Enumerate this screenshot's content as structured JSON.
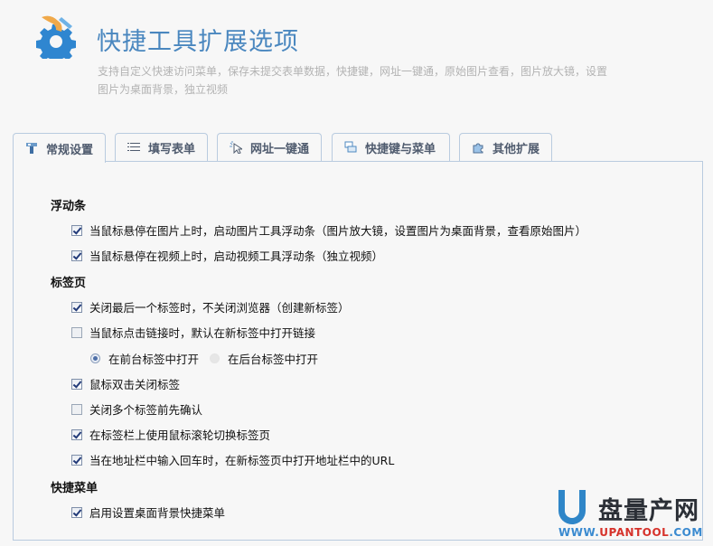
{
  "header": {
    "title": "快捷工具扩展选项",
    "subtitle": "支持自定义快速访问菜单，保存未提交表单数据，快捷键，网址一键通，原始图片查看，图片放大镜，设置图片为桌面背景，独立视频",
    "logo_icon": "gear-wrench-icon"
  },
  "tabs": [
    {
      "label": "常规设置",
      "icon": "wrench-icon",
      "active": true
    },
    {
      "label": "填写表单",
      "icon": "list-icon",
      "active": false
    },
    {
      "label": "网址一键通",
      "icon": "cursor-click-icon",
      "active": false
    },
    {
      "label": "快捷键与菜单",
      "icon": "keyboard-icon",
      "active": false
    },
    {
      "label": "其他扩展",
      "icon": "puzzle-icon",
      "active": false
    }
  ],
  "sections": {
    "float_bar": {
      "title": "浮动条",
      "options": [
        {
          "label": "当鼠标悬停在图片上时，启动图片工具浮动条（图片放大镜，设置图片为桌面背景，查看原始图片）",
          "checked": true
        },
        {
          "label": "当鼠标悬停在视频上时，启动视频工具浮动条（独立视频）",
          "checked": true
        }
      ]
    },
    "tabs_page": {
      "title": "标签页",
      "options": [
        {
          "label": "关闭最后一个标签时，不关闭浏览器（创建新标签）",
          "checked": true
        },
        {
          "label": "当鼠标点击链接时，默认在新标签中打开链接",
          "checked": false
        },
        {
          "label": "鼠标双击关闭标签",
          "checked": true
        },
        {
          "label": "关闭多个标签前先确认",
          "checked": false
        },
        {
          "label": "在标签栏上使用鼠标滚轮切换标签页",
          "checked": true
        },
        {
          "label": "当在地址栏中输入回车时，在新标签页中打开地址栏中的URL",
          "checked": true
        }
      ],
      "radios": [
        {
          "label": "在前台标签中打开",
          "selected": true
        },
        {
          "label": "在后台标签中打开",
          "selected": false
        }
      ]
    },
    "quick_menu": {
      "title": "快捷菜单",
      "options": [
        {
          "label": "启用设置桌面背景快捷菜单",
          "checked": true
        }
      ]
    }
  },
  "watermark": {
    "text": "盘量产网",
    "url_prefix": "WWW.",
    "url_main": "UPANTOOL",
    "url_suffix": ".COM"
  },
  "colors": {
    "title": "#4a87bf",
    "subtitle": "#b3b3b3",
    "border": "#b9cbdf",
    "background": "#f7f7f7"
  }
}
